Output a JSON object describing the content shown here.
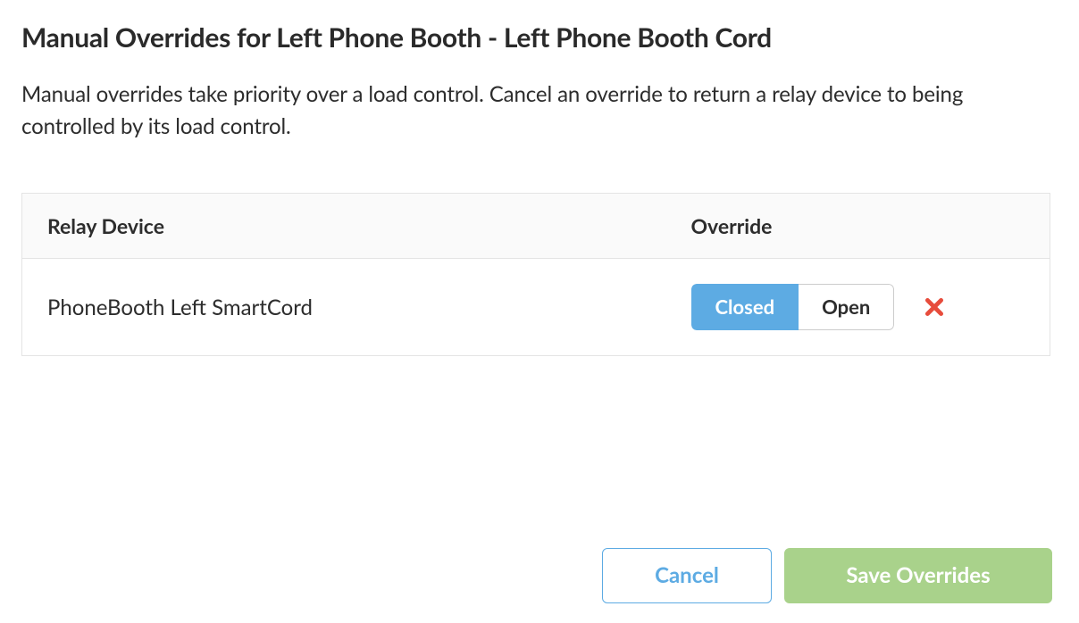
{
  "dialog": {
    "title": "Manual Overrides for Left Phone Booth - Left Phone Booth Cord",
    "description": "Manual overrides take priority over a load control. Cancel an override to return a relay device to being controlled by its load control."
  },
  "table": {
    "headers": {
      "relay_device": "Relay Device",
      "override": "Override"
    },
    "rows": [
      {
        "device_name": "PhoneBooth Left SmartCord",
        "closed_label": "Closed",
        "open_label": "Open",
        "state": "closed"
      }
    ]
  },
  "footer": {
    "cancel_label": "Cancel",
    "save_label": "Save Overrides"
  }
}
